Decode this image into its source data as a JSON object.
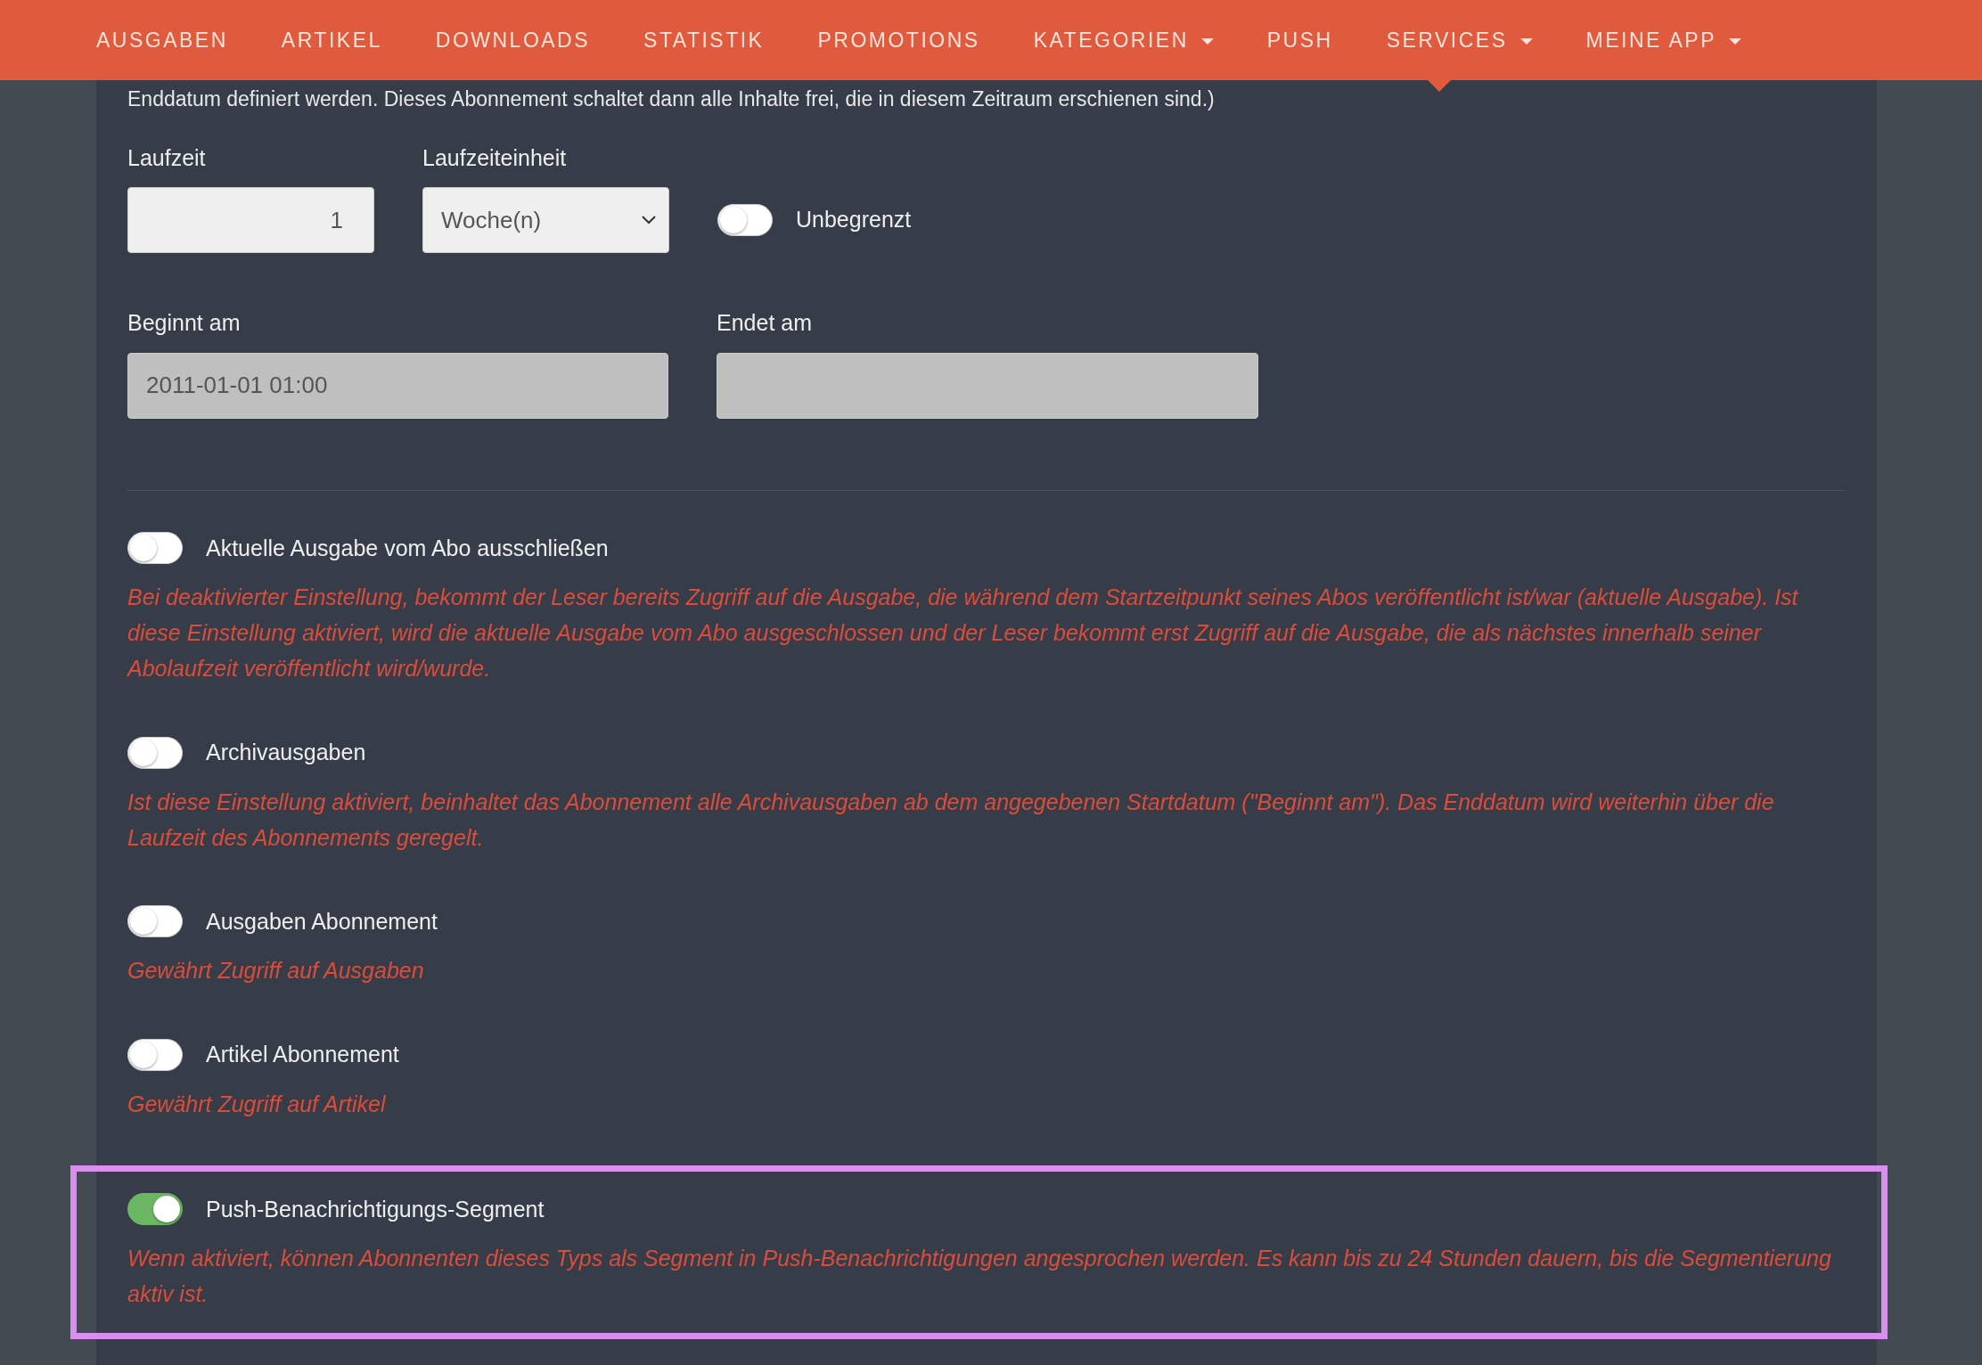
{
  "navbar": {
    "items": [
      {
        "label": "AUSGABEN",
        "dropdown": false
      },
      {
        "label": "ARTIKEL",
        "dropdown": false
      },
      {
        "label": "DOWNLOADS",
        "dropdown": false
      },
      {
        "label": "STATISTIK",
        "dropdown": false
      },
      {
        "label": "PROMOTIONS",
        "dropdown": false
      },
      {
        "label": "KATEGORIEN",
        "dropdown": true
      },
      {
        "label": "PUSH",
        "dropdown": false
      },
      {
        "label": "SERVICES",
        "dropdown": true
      },
      {
        "label": "MEINE APP",
        "dropdown": true
      }
    ]
  },
  "intro_text": "Enddatum definiert werden. Dieses Abonnement schaltet dann alle Inhalte frei, die in diesem Zeitraum erschienen sind.)",
  "duration": {
    "label": "Laufzeit",
    "value": "1"
  },
  "duration_unit": {
    "label": "Laufzeiteinheit",
    "value": "Woche(n)"
  },
  "unlimited": {
    "label": "Unbegrenzt",
    "on": false
  },
  "start": {
    "label": "Beginnt am",
    "value": "2011-01-01 01:00"
  },
  "end": {
    "label": "Endet am"
  },
  "options": [
    {
      "label": "Aktuelle Ausgabe vom Abo ausschließen",
      "on": false,
      "highlighted": false,
      "description": "Bei deaktivierter Einstellung, bekommt der Leser bereits Zugriff auf die Ausgabe, die während dem Startzeitpunkt seines Abos veröffentlicht ist/war (aktuelle Ausgabe). Ist diese Einstellung aktiviert, wird die aktuelle Ausgabe vom Abo ausgeschlossen und der Leser bekommt erst Zugriff auf die Ausgabe, die als nächstes innerhalb seiner Abolaufzeit veröffentlicht wird/wurde."
    },
    {
      "label": "Archivausgaben",
      "on": false,
      "highlighted": false,
      "description": "Ist diese Einstellung aktiviert, beinhaltet das Abonnement alle Archivausgaben ab dem angegebenen Startdatum (\"Beginnt am\"). Das Enddatum wird weiterhin über die Laufzeit des Abonnements geregelt."
    },
    {
      "label": "Ausgaben Abonnement",
      "on": false,
      "highlighted": false,
      "description": "Gewährt Zugriff auf Ausgaben"
    },
    {
      "label": "Artikel Abonnement",
      "on": false,
      "highlighted": false,
      "description": "Gewährt Zugriff auf Artikel"
    },
    {
      "label": "Push-Benachrichtigungs-Segment",
      "on": true,
      "highlighted": true,
      "description": "Wenn aktiviert, können Abonnenten dieses Typs als Segment in Push-Benachrichtigungen angesprochen werden. Es kann bis zu 24 Stunden dauern, bis die Segmentierung aktiv ist."
    }
  ]
}
